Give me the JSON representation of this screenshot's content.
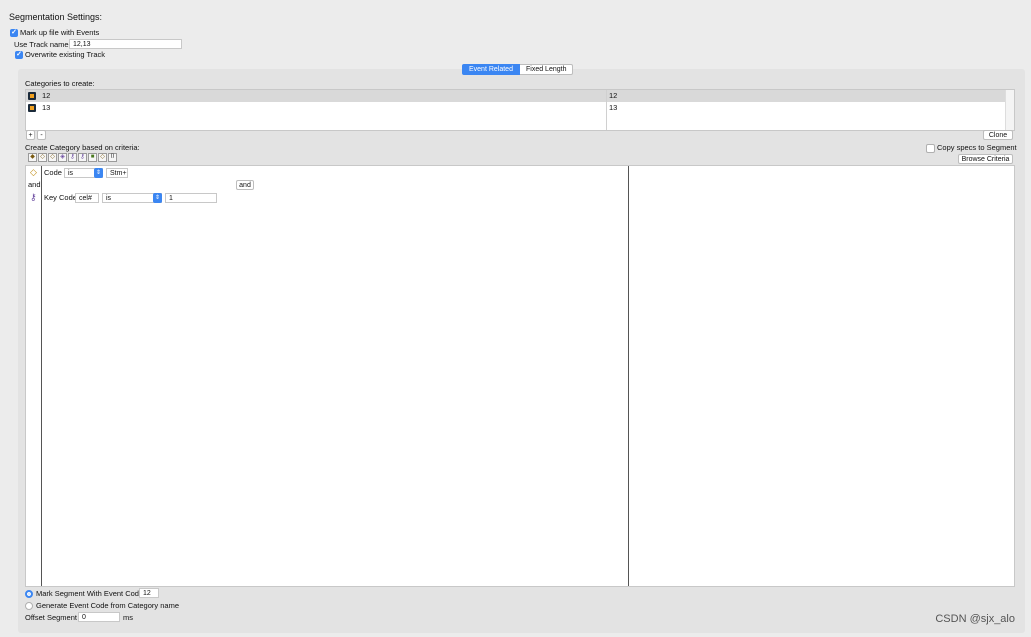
{
  "header": {
    "title": "Segmentation Settings:"
  },
  "options": {
    "markup_label": "Mark up file with Events",
    "markup_checked": true,
    "track_name_label": "Use Track name:",
    "track_name_value": "12,13",
    "overwrite_label": "Overwrite existing Track",
    "overwrite_checked": true
  },
  "tabs": [
    {
      "label": "Event Related",
      "selected": true
    },
    {
      "label": "Fixed Length",
      "selected": false
    }
  ],
  "categories": {
    "label": "Categories to create:",
    "rows": [
      {
        "name": "12",
        "value": "12"
      },
      {
        "name": "13",
        "value": "13"
      }
    ],
    "add_label": "+",
    "remove_label": "-",
    "clone_label": "Clone"
  },
  "criteria": {
    "label": "Create Category based on criteria:",
    "copy_specs_label": "Copy specs to Segment",
    "browse_label": "Browse Criteria",
    "toolbar_icons": [
      "criteria-stack-icon",
      "event-diamond-icon",
      "event-diamond-icon",
      "event-diamond-icon",
      "key-icon",
      "key-icon",
      "trigger-icon",
      "event-diamond-icon",
      "bracket-icon"
    ],
    "row1": {
      "field": "Code",
      "operator": "is",
      "value": "Stm+"
    },
    "connector": "and",
    "and_button": "and",
    "row2": {
      "field": "Key Code",
      "subfield": "cel#",
      "operator": "is",
      "value": "1"
    }
  },
  "footer": {
    "mark_segment_label": "Mark Segment With Event Code:",
    "mark_segment_value": "12",
    "generate_label": "Generate Event Code from Category name",
    "offset_label": "Offset Segment",
    "offset_value": "0",
    "offset_unit": "ms"
  },
  "watermark": "CSDN @sjx_alo",
  "colors": {
    "accent": "#3b86f2",
    "background": "#ececec",
    "panel": "#e3e3e3"
  }
}
